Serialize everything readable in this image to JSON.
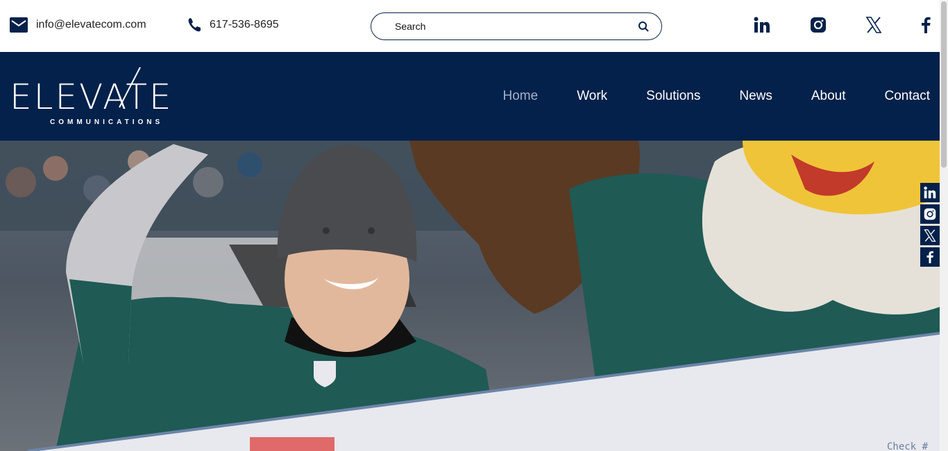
{
  "topbar": {
    "email": "info@elevatecom.com",
    "phone": "617-536-8695",
    "search_placeholder": "Search",
    "social": [
      "linkedin-icon",
      "instagram-icon",
      "x-icon",
      "facebook-icon"
    ]
  },
  "brand": {
    "name": "ELEVATE",
    "subtitle": "COMMUNICATIONS"
  },
  "nav": {
    "items": [
      {
        "label": "Home",
        "active": true
      },
      {
        "label": "Work",
        "active": false
      },
      {
        "label": "Solutions",
        "active": false
      },
      {
        "label": "News",
        "active": false
      },
      {
        "label": "About",
        "active": false
      },
      {
        "label": "Contact",
        "active": false
      }
    ]
  },
  "hero": {
    "check_text": "Check #"
  },
  "colors": {
    "navy": "#03214a",
    "active_nav": "#9fb3cc",
    "jersey_green": "#1f5a55"
  }
}
